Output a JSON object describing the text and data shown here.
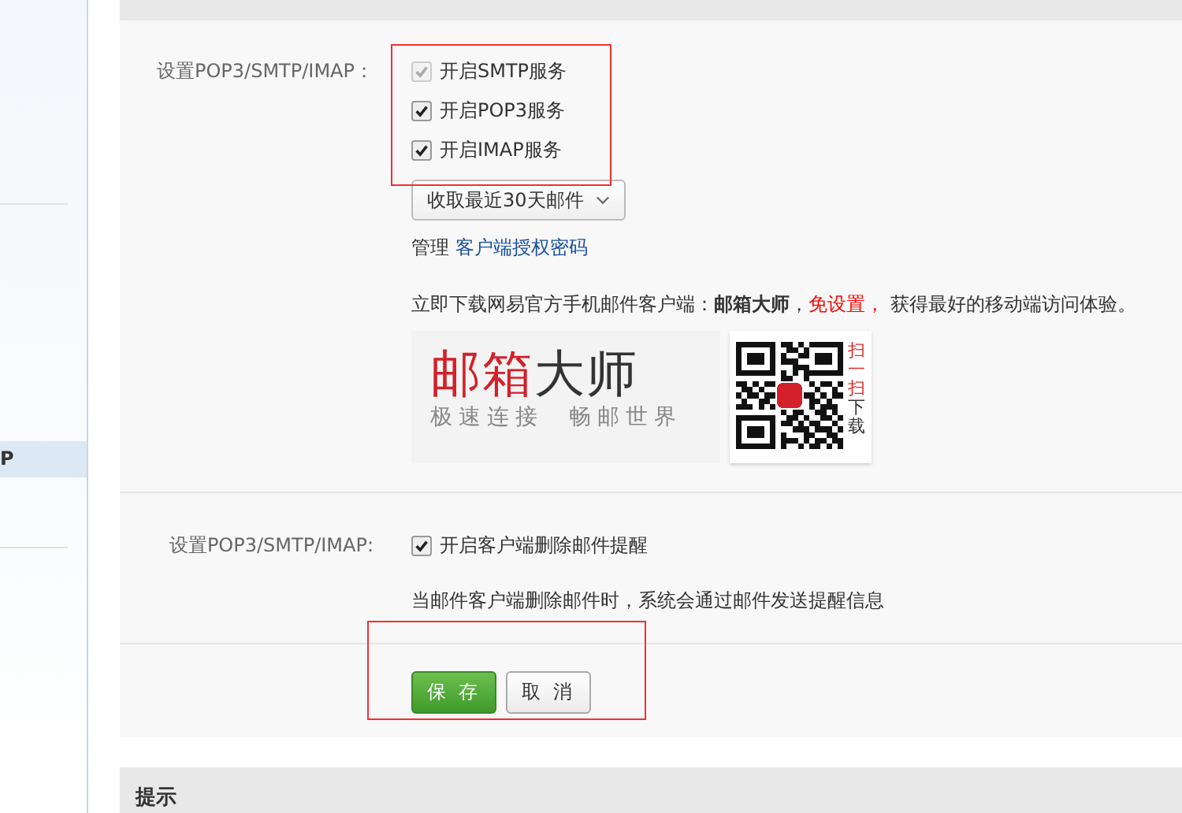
{
  "sidebar": {
    "items": [
      {
        "label": "P",
        "selected": true
      }
    ]
  },
  "settings": {
    "label": "设置POP3/SMTP/IMAP：",
    "services": [
      {
        "label": "开启SMTP服务",
        "checked": true,
        "disabled": true
      },
      {
        "label": "开启POP3服务",
        "checked": true,
        "disabled": false
      },
      {
        "label": "开启IMAP服务",
        "checked": true,
        "disabled": false
      }
    ],
    "fetch_range": "收取最近30天邮件",
    "manage_label": "管理",
    "manage_link": "客户端授权密码",
    "promo_text": "立即下载网易官方手机邮件客户端：**邮箱大师**，",
    "promo_highlight": "免设置，",
    "promo_tail": " 获得最好的移动端访问体验。",
    "promo_logo_red": "邮箱",
    "promo_logo_dark": "大师",
    "promo_slogan_1": "极速连接",
    "promo_slogan_2": "畅邮世界",
    "qr_scan": "扫一扫",
    "qr_download": "下载"
  },
  "delete_notice": {
    "label": "设置POP3/SMTP/IMAP:",
    "option": {
      "label": "开启客户端删除邮件提醒",
      "checked": true
    },
    "hint": "当邮件客户端删除邮件时，系统会通过邮件发送提醒信息"
  },
  "buttons": [
    {
      "label": "保 存",
      "kind": "primary"
    },
    {
      "label": "取 消",
      "kind": "secondary"
    }
  ],
  "tips": {
    "title": "提示"
  }
}
